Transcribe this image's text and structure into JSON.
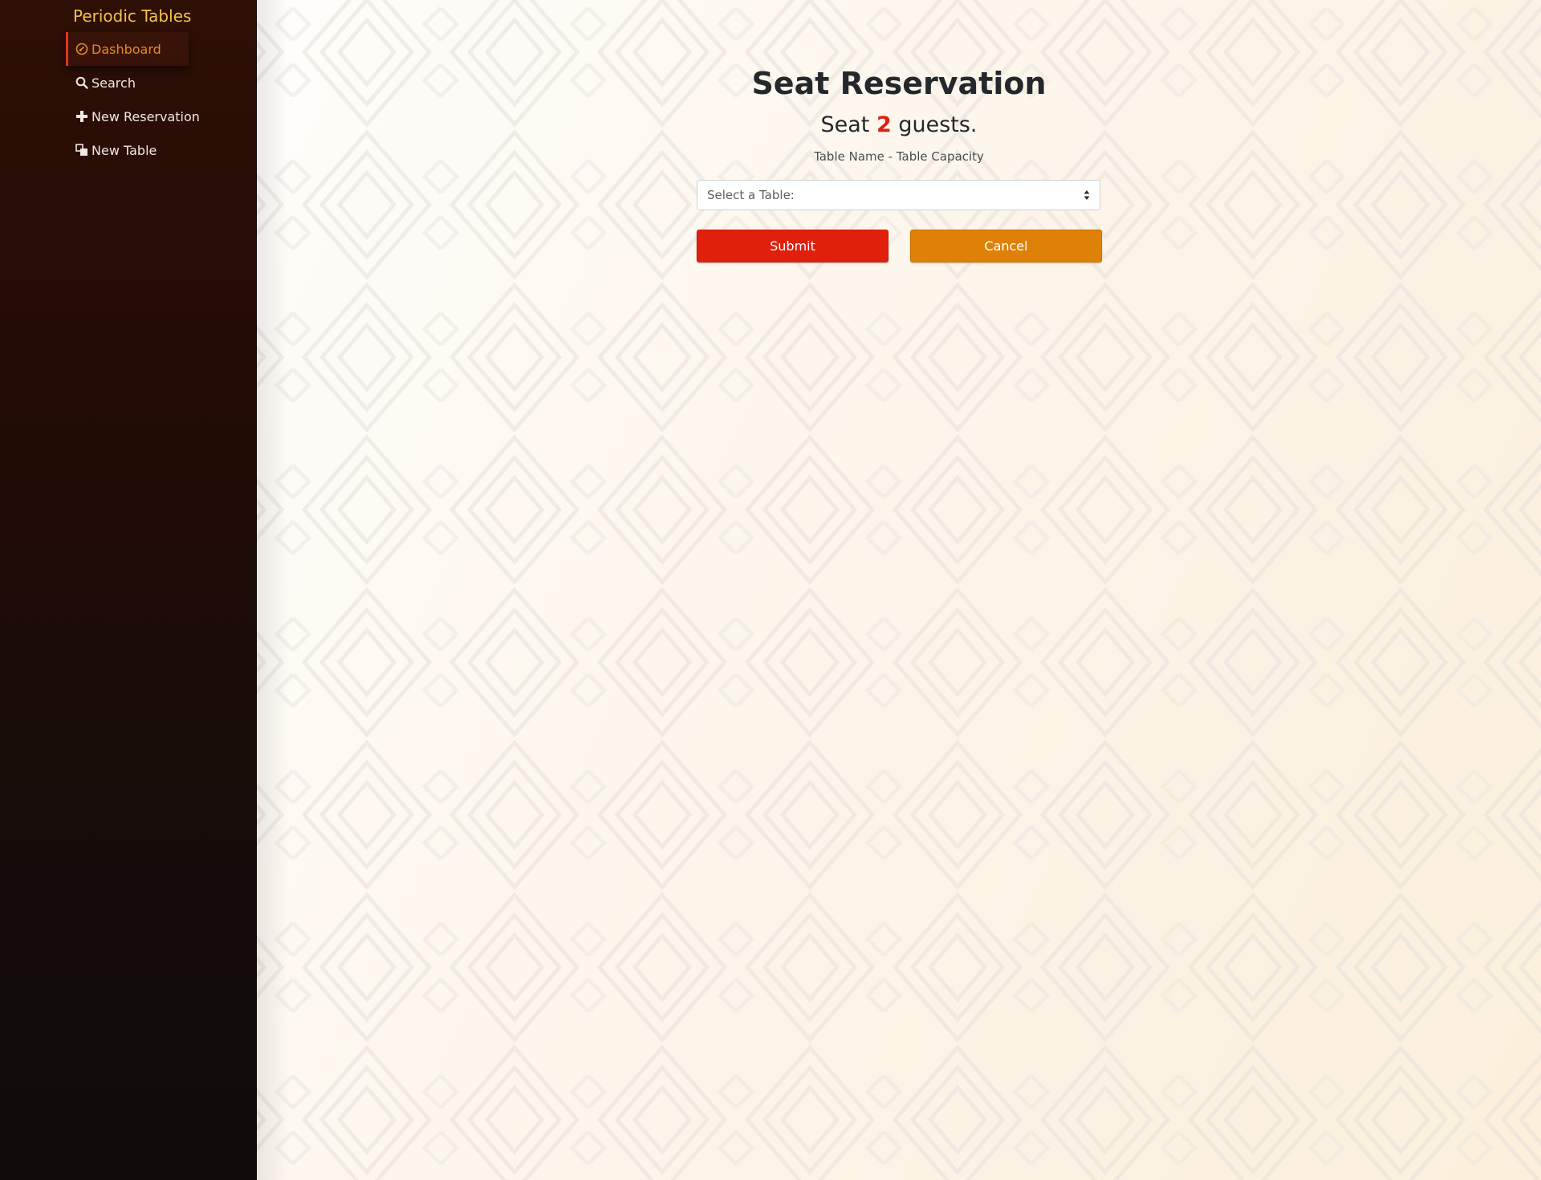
{
  "sidebar": {
    "brand": "Periodic Tables",
    "items": [
      {
        "label": "Dashboard",
        "icon": "dashboard-icon",
        "active": true
      },
      {
        "label": "Search",
        "icon": "search-icon",
        "active": false
      },
      {
        "label": "New Reservation",
        "icon": "plus-icon",
        "active": false
      },
      {
        "label": "New Table",
        "icon": "table-icon",
        "active": false
      }
    ]
  },
  "main": {
    "title": "Seat Reservation",
    "subtitle_prefix": "Seat",
    "guest_count": "2",
    "subtitle_suffix": "guests.",
    "hint": "Table Name - Table Capacity",
    "table_select": {
      "placeholder": "Select a Table:"
    },
    "submit_label": "Submit",
    "cancel_label": "Cancel"
  },
  "colors": {
    "brand": "#f2c34a",
    "active_nav": "#e58a20",
    "submit": "#e0200c",
    "cancel": "#df8106",
    "accent_count": "#df1f0f"
  }
}
